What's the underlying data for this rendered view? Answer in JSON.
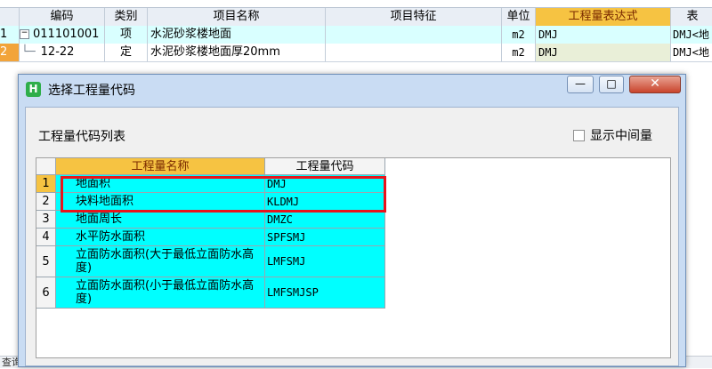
{
  "background_table": {
    "headers": [
      "编码",
      "类别",
      "项目名称",
      "项目特征",
      "单位",
      "工程量表达式",
      "表"
    ],
    "rows": [
      {
        "num": "1",
        "tree": "−",
        "code": "011101001",
        "type": "项",
        "name": "水泥砂浆楼地面",
        "feature": "",
        "unit": "m2",
        "expr": "DMJ",
        "extra": "DMJ<地"
      },
      {
        "num": "2",
        "tree": "└─",
        "code": "12-22",
        "type": "定",
        "name": "水泥砂浆楼地面厚20mm",
        "feature": "",
        "unit": "m2",
        "expr": "DMJ",
        "extra": "DMJ<地"
      }
    ],
    "status_fragment": "查询"
  },
  "dialog": {
    "title": "选择工程量代码",
    "app_icon": "H",
    "min_label": "—",
    "max_label": "□",
    "close_label": "✕",
    "list_title": "工程量代码列表",
    "show_intermediate_label": "显示中间量",
    "show_intermediate_checked": false,
    "table": {
      "headers": [
        "工程量名称",
        "工程量代码"
      ],
      "rows": [
        {
          "num": "1",
          "name": "地面积",
          "code": "DMJ"
        },
        {
          "num": "2",
          "name": "块料地面积",
          "code": "KLDMJ"
        },
        {
          "num": "3",
          "name": "地面周长",
          "code": "DMZC"
        },
        {
          "num": "4",
          "name": "水平防水面积",
          "code": "SPFSMJ"
        },
        {
          "num": "5",
          "name": "立面防水面积(大于最低立面防水高度)",
          "code": "LMFSMJ"
        },
        {
          "num": "6",
          "name": "立面防水面积(小于最低立面防水高度)",
          "code": "LMFSMJSP"
        }
      ]
    }
  },
  "colors": {
    "highlight_header": "#f6c342",
    "data_cell": "#00ffff",
    "selection_box": "#e8141c",
    "row_selected_bg": "#d9ffff"
  }
}
